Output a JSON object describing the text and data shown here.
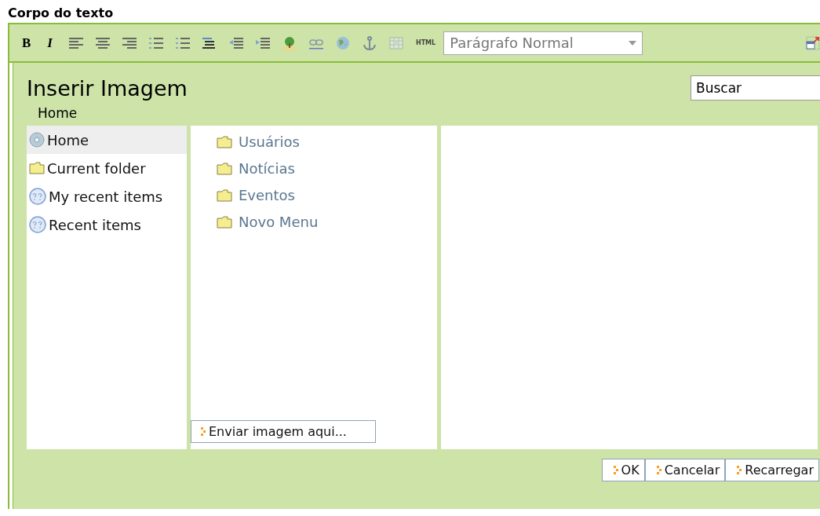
{
  "heading": "Corpo do texto",
  "toolbar": {
    "items": [
      {
        "kind": "bold",
        "label": "B"
      },
      {
        "kind": "italic",
        "label": "I"
      },
      {
        "kind": "align-left"
      },
      {
        "kind": "align-center"
      },
      {
        "kind": "align-right"
      },
      {
        "kind": "numbered-list"
      },
      {
        "kind": "bullet-list"
      },
      {
        "kind": "indent-lines"
      },
      {
        "kind": "outdent"
      },
      {
        "kind": "indent"
      },
      {
        "kind": "tree"
      },
      {
        "kind": "link"
      },
      {
        "kind": "globe"
      },
      {
        "kind": "anchor"
      },
      {
        "kind": "table"
      },
      {
        "kind": "html",
        "label": "HTML"
      }
    ],
    "style_select": {
      "value": "Parágrafo Normal"
    }
  },
  "dialog": {
    "title": "Inserir Imagem",
    "search": {
      "value": "Buscar"
    },
    "breadcrumb": "Home",
    "sidebar": {
      "items": [
        {
          "kind": "home",
          "label": "Home",
          "selected": true
        },
        {
          "kind": "folder",
          "label": "Current folder",
          "selected": false
        },
        {
          "kind": "recent",
          "label": "My recent items",
          "selected": false
        },
        {
          "kind": "recent",
          "label": "Recent items",
          "selected": false
        }
      ]
    },
    "folders": [
      {
        "label": "Usuários"
      },
      {
        "label": "Notícias"
      },
      {
        "label": "Eventos"
      },
      {
        "label": "Novo Menu"
      }
    ],
    "upload_button": "Enviar imagem aqui...",
    "buttons": [
      "OK",
      "Cancelar",
      "Recarregar"
    ]
  }
}
